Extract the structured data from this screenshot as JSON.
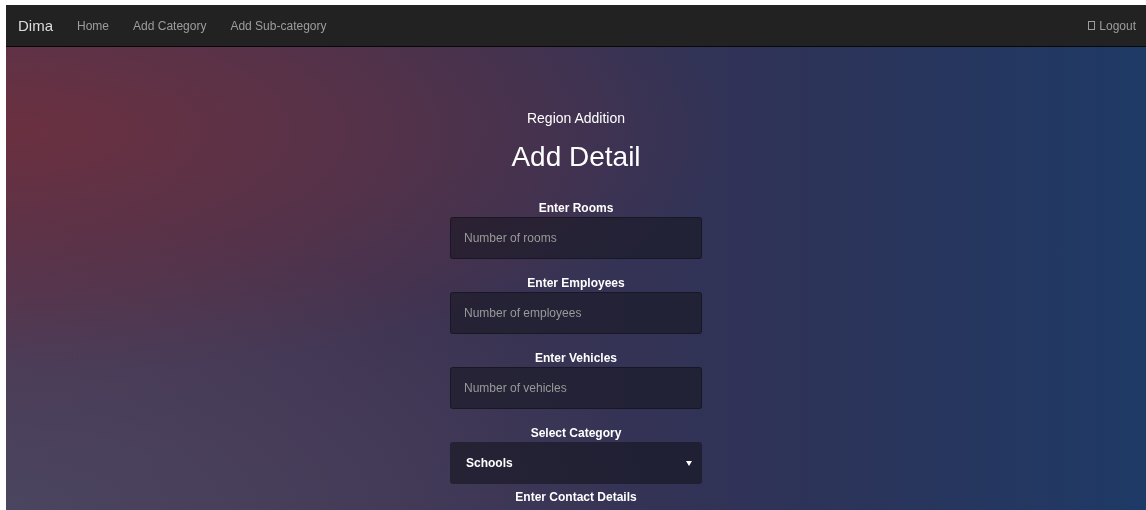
{
  "navbar": {
    "brand": "Dima",
    "links": [
      {
        "label": "Home"
      },
      {
        "label": "Add Category"
      },
      {
        "label": "Add Sub-category"
      }
    ],
    "logout": "Logout"
  },
  "form": {
    "subtitle": "Region Addition",
    "title": "Add Detail",
    "fields": [
      {
        "kind": "input",
        "label": "Enter Rooms",
        "placeholder": "Number of rooms"
      },
      {
        "kind": "input",
        "label": "Enter Employees",
        "placeholder": "Number of employees"
      },
      {
        "kind": "input",
        "label": "Enter Vehicles",
        "placeholder": "Number of vehicles"
      },
      {
        "kind": "select",
        "label": "Select Category",
        "value": "Schools"
      },
      {
        "kind": "heading",
        "label": "Enter Contact Details"
      }
    ]
  }
}
